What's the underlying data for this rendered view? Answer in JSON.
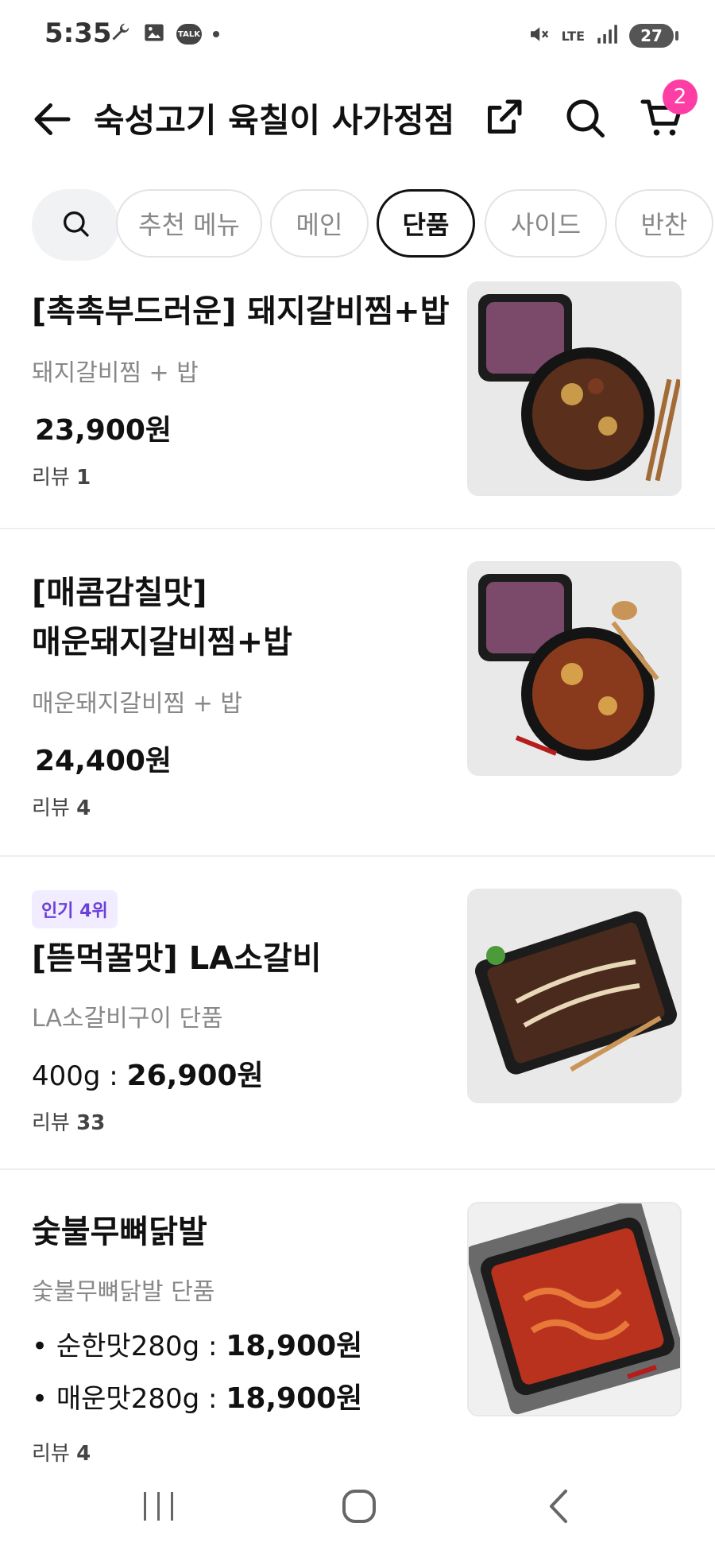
{
  "status_bar": {
    "time": "5:35",
    "left_icons": [
      "wrench-icon",
      "image-icon",
      "talk-icon",
      "dot-icon"
    ],
    "talk_label": "TALK",
    "network": "LTE",
    "battery": "27",
    "right_icons": [
      "mute-icon",
      "lte-icon",
      "signal-icon",
      "battery-icon"
    ]
  },
  "header": {
    "title": "숙성고기 육칠이 사가정점",
    "cart_count": "2",
    "icons": [
      "back-arrow-icon",
      "share-icon",
      "search-icon",
      "cart-icon"
    ]
  },
  "tabs": {
    "items": [
      {
        "label": "추천 메뉴",
        "active": false
      },
      {
        "label": "메인",
        "active": false
      },
      {
        "label": "단품",
        "active": true
      },
      {
        "label": "사이드",
        "active": false
      },
      {
        "label": "반찬",
        "active": false
      }
    ]
  },
  "menu": {
    "items": [
      {
        "name": "[촉촉부드러운] 돼지갈비찜+밥",
        "desc": "돼지갈비찜 + 밥",
        "price": "23,900원",
        "review_label": "리뷰",
        "review_count": "1"
      },
      {
        "name_line1": "[매콤감칠맛]",
        "name_line2": "매운돼지갈비찜+밥",
        "desc": "매운돼지갈비찜 + 밥",
        "price": "24,400원",
        "review_label": "리뷰",
        "review_count": "4"
      },
      {
        "badge": "인기 4위",
        "name": "[뜯먹꿀맛] LA소갈비",
        "desc": "LA소갈비구이 단품",
        "option": "400g :",
        "price": "26,900원",
        "review_label": "리뷰",
        "review_count": "33"
      },
      {
        "name": "숯불무뼈닭발",
        "desc": "숯불무뼈닭발 단품",
        "options": [
          {
            "label": "• 순한맛280g :",
            "price": "18,900원"
          },
          {
            "label": "• 매운맛280g :",
            "price": "18,900원"
          }
        ],
        "review_label": "리뷰",
        "review_count": "4"
      }
    ]
  },
  "nav_bar": {
    "icons": [
      "recent-apps-icon",
      "home-icon",
      "back-icon"
    ]
  },
  "colors": {
    "accent_badge": "#ff3ea5",
    "popular_badge_text": "#6b3fd9",
    "popular_badge_bg": "#f1ecff"
  }
}
